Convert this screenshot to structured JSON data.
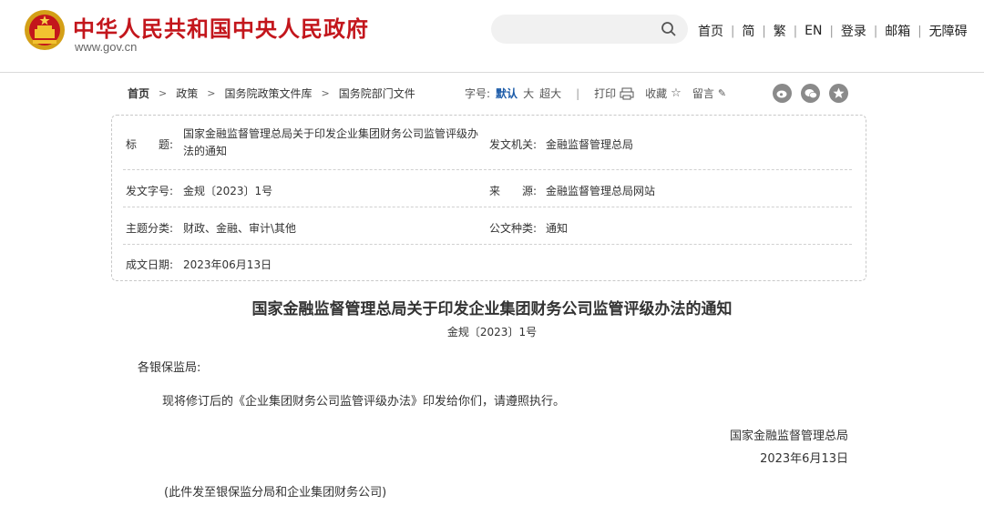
{
  "header": {
    "site_name": "中华人民共和国中央人民政府",
    "domain": "www.gov.cn",
    "search_placeholder": "",
    "nav": [
      "首页",
      "简",
      "繁",
      "EN",
      "登录",
      "邮箱",
      "无障碍"
    ]
  },
  "breadcrumb": [
    "首页",
    "政策",
    "国务院政策文件库",
    "国务院部门文件"
  ],
  "tools": {
    "font_label": "字号:",
    "font_default": "默认",
    "font_large": "大",
    "font_xlarge": "超大",
    "print": "打印",
    "favorite": "收藏",
    "comment": "留言"
  },
  "share_icons": [
    "weibo-icon",
    "wechat-icon",
    "qzone-icon"
  ],
  "info": {
    "title_label": "标　　题:",
    "title_value": "国家金融监督管理总局关于印发企业集团财务公司监管评级办法的通知",
    "issuer_label": "发文机关:",
    "issuer_value": "金融监督管理总局",
    "doc_no_label": "发文字号:",
    "doc_no_value": "金规〔2023〕1号",
    "source_label": "来　　源:",
    "source_value": "金融监督管理总局网站",
    "topic_label": "主题分类:",
    "topic_value": "财政、金融、审计\\其他",
    "type_label": "公文种类:",
    "type_value": "通知",
    "date_label": "成文日期:",
    "date_value": "2023年06月13日"
  },
  "document": {
    "title": "国家金融监督管理总局关于印发企业集团财务公司监管评级办法的通知",
    "number": "金规〔2023〕1号",
    "salutation": "各银保监局:",
    "body": "现将修订后的《企业集团财务公司监管评级办法》印发给你们，请遵照执行。",
    "signature": "国家金融监督管理总局",
    "date": "2023年6月13日",
    "note": "(此件发至银保监分局和企业集团财务公司)"
  },
  "colors": {
    "brand_red": "#c3161c",
    "link_blue": "#1a5aa8"
  }
}
